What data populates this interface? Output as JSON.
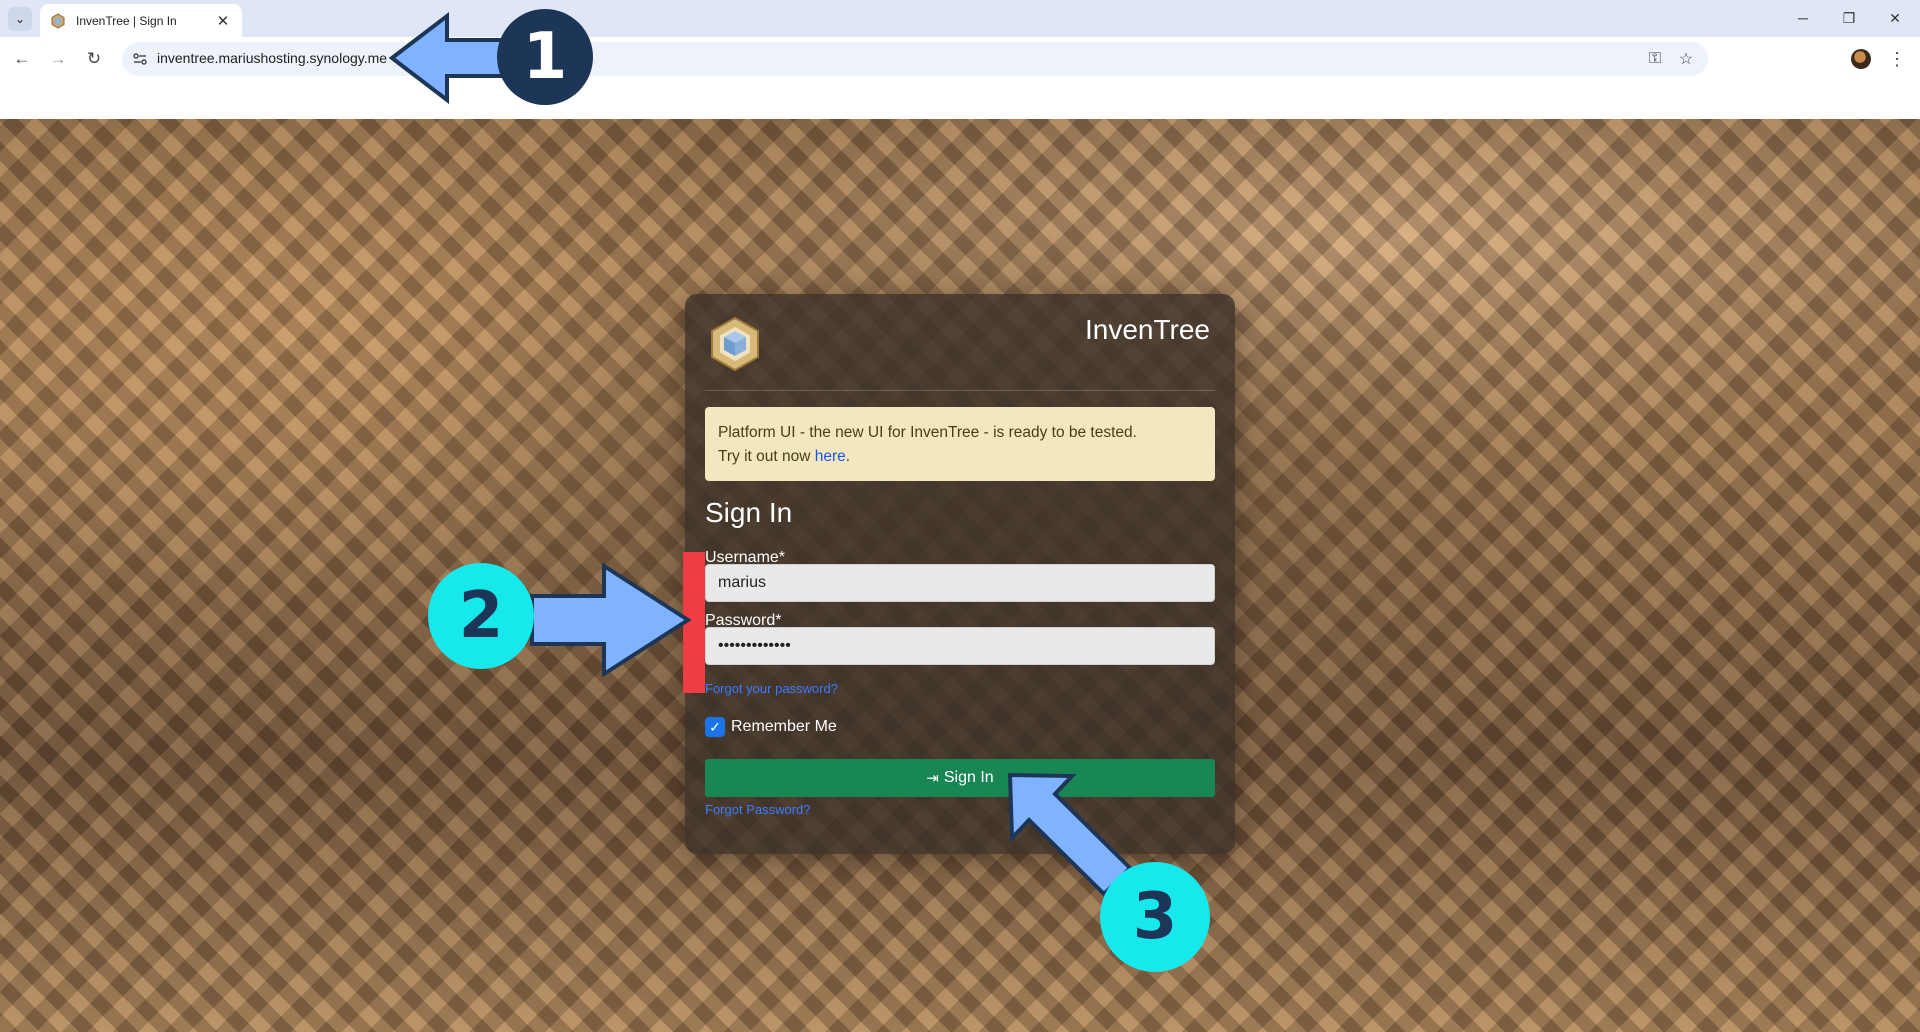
{
  "browser": {
    "tab_title": "InvenTree | Sign In",
    "tab_close": "✕",
    "url": "inventree.mariushosting.synology.me",
    "window_controls": {
      "minimize": "─",
      "restore": "❐",
      "close": "✕"
    }
  },
  "card": {
    "brand": "InvenTree",
    "alert": {
      "line1": "Platform UI - the new UI for InvenTree - is ready to be tested.",
      "line2_prefix": "Try it out now ",
      "link_text": "here",
      "line2_suffix": "."
    },
    "title": "Sign In",
    "username": {
      "label": "Username*",
      "value": "marius"
    },
    "password": {
      "label": "Password*",
      "value": "•••••••••••••"
    },
    "forgot_password_link": "Forgot your password?",
    "remember_me": {
      "label": "Remember Me",
      "checked": true
    },
    "signin_button": "Sign In",
    "forgot_password_bottom": "Forgot Password?"
  },
  "overlay": {
    "badges": [
      "1",
      "2",
      "3"
    ],
    "colors": {
      "dark_badge": "#1d3557",
      "cyan_badge": "#17e8ec",
      "arrow": "#7fb3ff",
      "marker": "#ef3d44"
    }
  },
  "colors": {
    "button_green": "#198754",
    "link_blue": "#3b7bff",
    "alert_bg": "#f4e7c0"
  }
}
